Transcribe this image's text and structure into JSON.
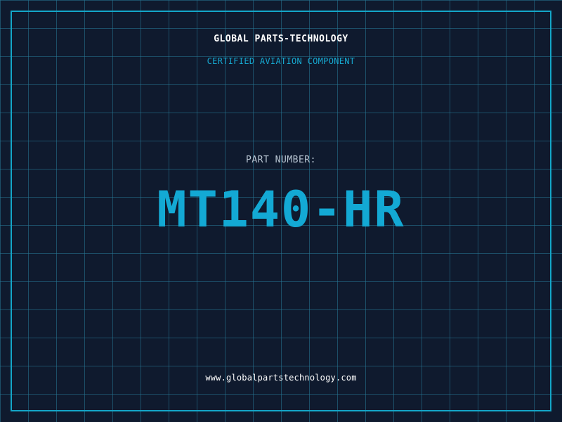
{
  "header": {
    "company": "GLOBAL PARTS-TECHNOLOGY",
    "tagline": "CERTIFIED AVIATION COMPONENT"
  },
  "part": {
    "label": "PART NUMBER:",
    "number": "MT140-HR"
  },
  "footer": {
    "website": "www.globalpartstechnology.com"
  },
  "colors": {
    "background": "#0f1a2e",
    "grid": "#26788f",
    "accent": "#14a6c8",
    "text": "#ffffff",
    "label": "#b9c6d3"
  }
}
